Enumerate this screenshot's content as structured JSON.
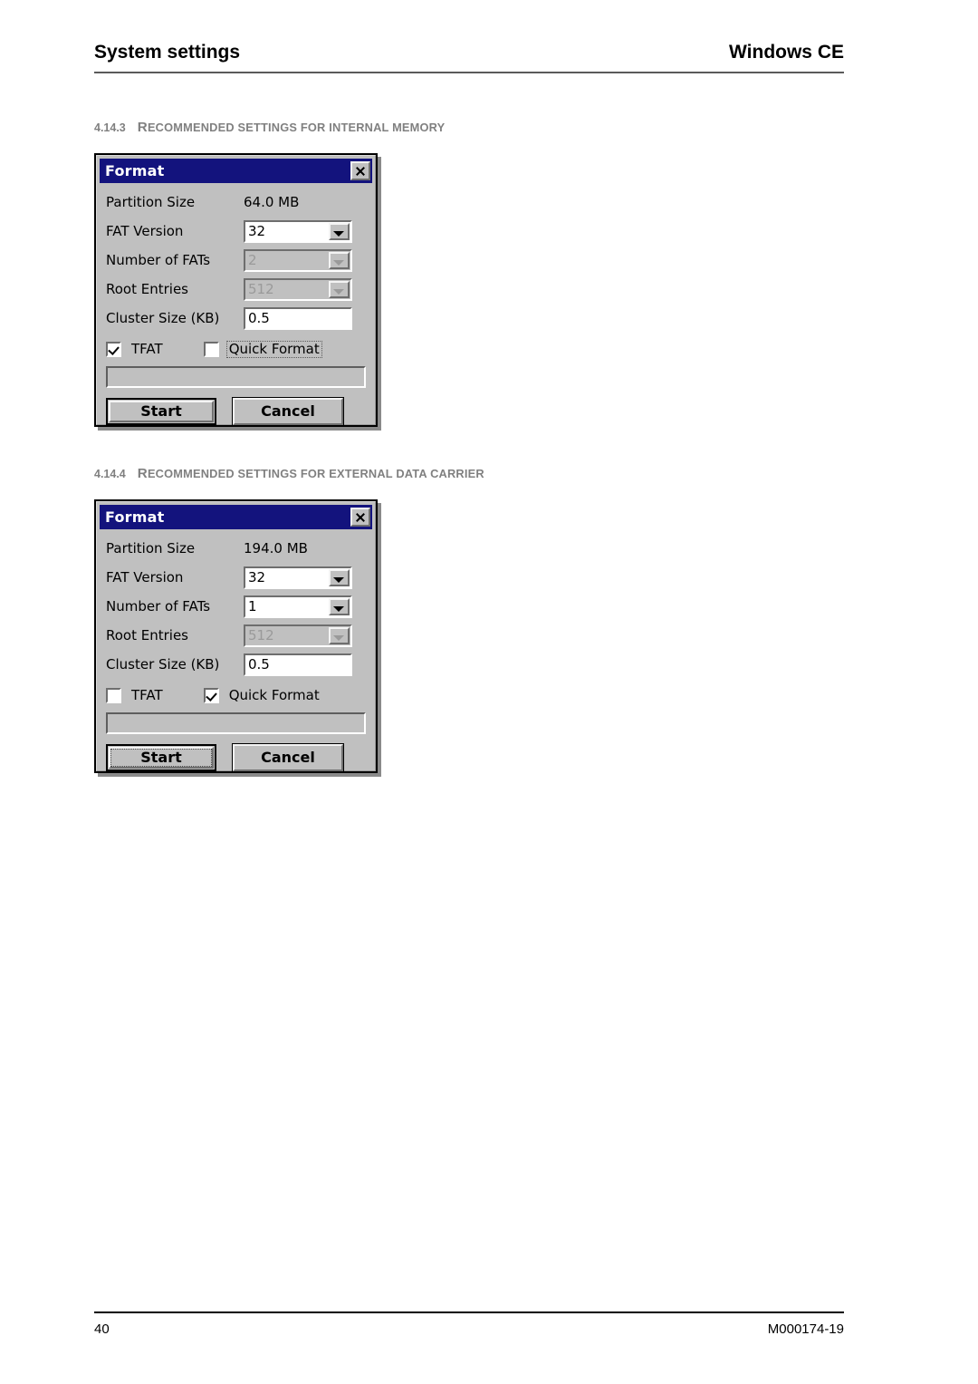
{
  "header": {
    "left_title": "System settings",
    "right_title": "Windows CE"
  },
  "sections": [
    {
      "number": "4.14.3",
      "title_cap": "R",
      "title_rest": "ECOMMENDED SETTINGS FOR INTERNAL MEMORY",
      "title_full": "RECOMMENDED SETTINGS FOR INTERNAL MEMORY"
    },
    {
      "number": "4.14.4",
      "title_cap": "R",
      "title_rest": "ECOMMENDED SETTINGS FOR EXTERNAL DATA CARRIER",
      "title_full": "RECOMMENDED SETTINGS FOR EXTERNAL DATA CARRIER"
    }
  ],
  "dialogs": [
    {
      "title": "Format",
      "close_icon": "close-icon",
      "partition_size_label": "Partition Size",
      "partition_size_value": "64.0 MB",
      "fat_version_label": "FAT Version",
      "fat_version_value": "32",
      "number_of_fats_label": "Number of FATs",
      "number_of_fats_value": "2",
      "root_entries_label": "Root Entries",
      "root_entries_value": "512",
      "cluster_size_label": "Cluster Size (KB)",
      "cluster_size_value": "0.5",
      "tfat_label": "TFAT",
      "quick_format_label": "Quick Format",
      "start_label": "Start",
      "cancel_label": "Cancel"
    },
    {
      "title": "Format",
      "close_icon": "close-icon",
      "partition_size_label": "Partition Size",
      "partition_size_value": "194.0 MB",
      "fat_version_label": "FAT Version",
      "fat_version_value": "32",
      "number_of_fats_label": "Number of FATs",
      "number_of_fats_value": "1",
      "root_entries_label": "Root Entries",
      "root_entries_value": "512",
      "cluster_size_label": "Cluster Size (KB)",
      "cluster_size_value": "0.5",
      "tfat_label": "TFAT",
      "quick_format_label": "Quick Format",
      "start_label": "Start",
      "cancel_label": "Cancel"
    }
  ],
  "footer": {
    "page_number": "40",
    "document_number": "M000174-19"
  },
  "colors": {
    "titlebar": "#13137d",
    "dialog_face": "#c0c0c0",
    "heading_gray": "#808080",
    "disabled_text": "#9a9a9a"
  }
}
